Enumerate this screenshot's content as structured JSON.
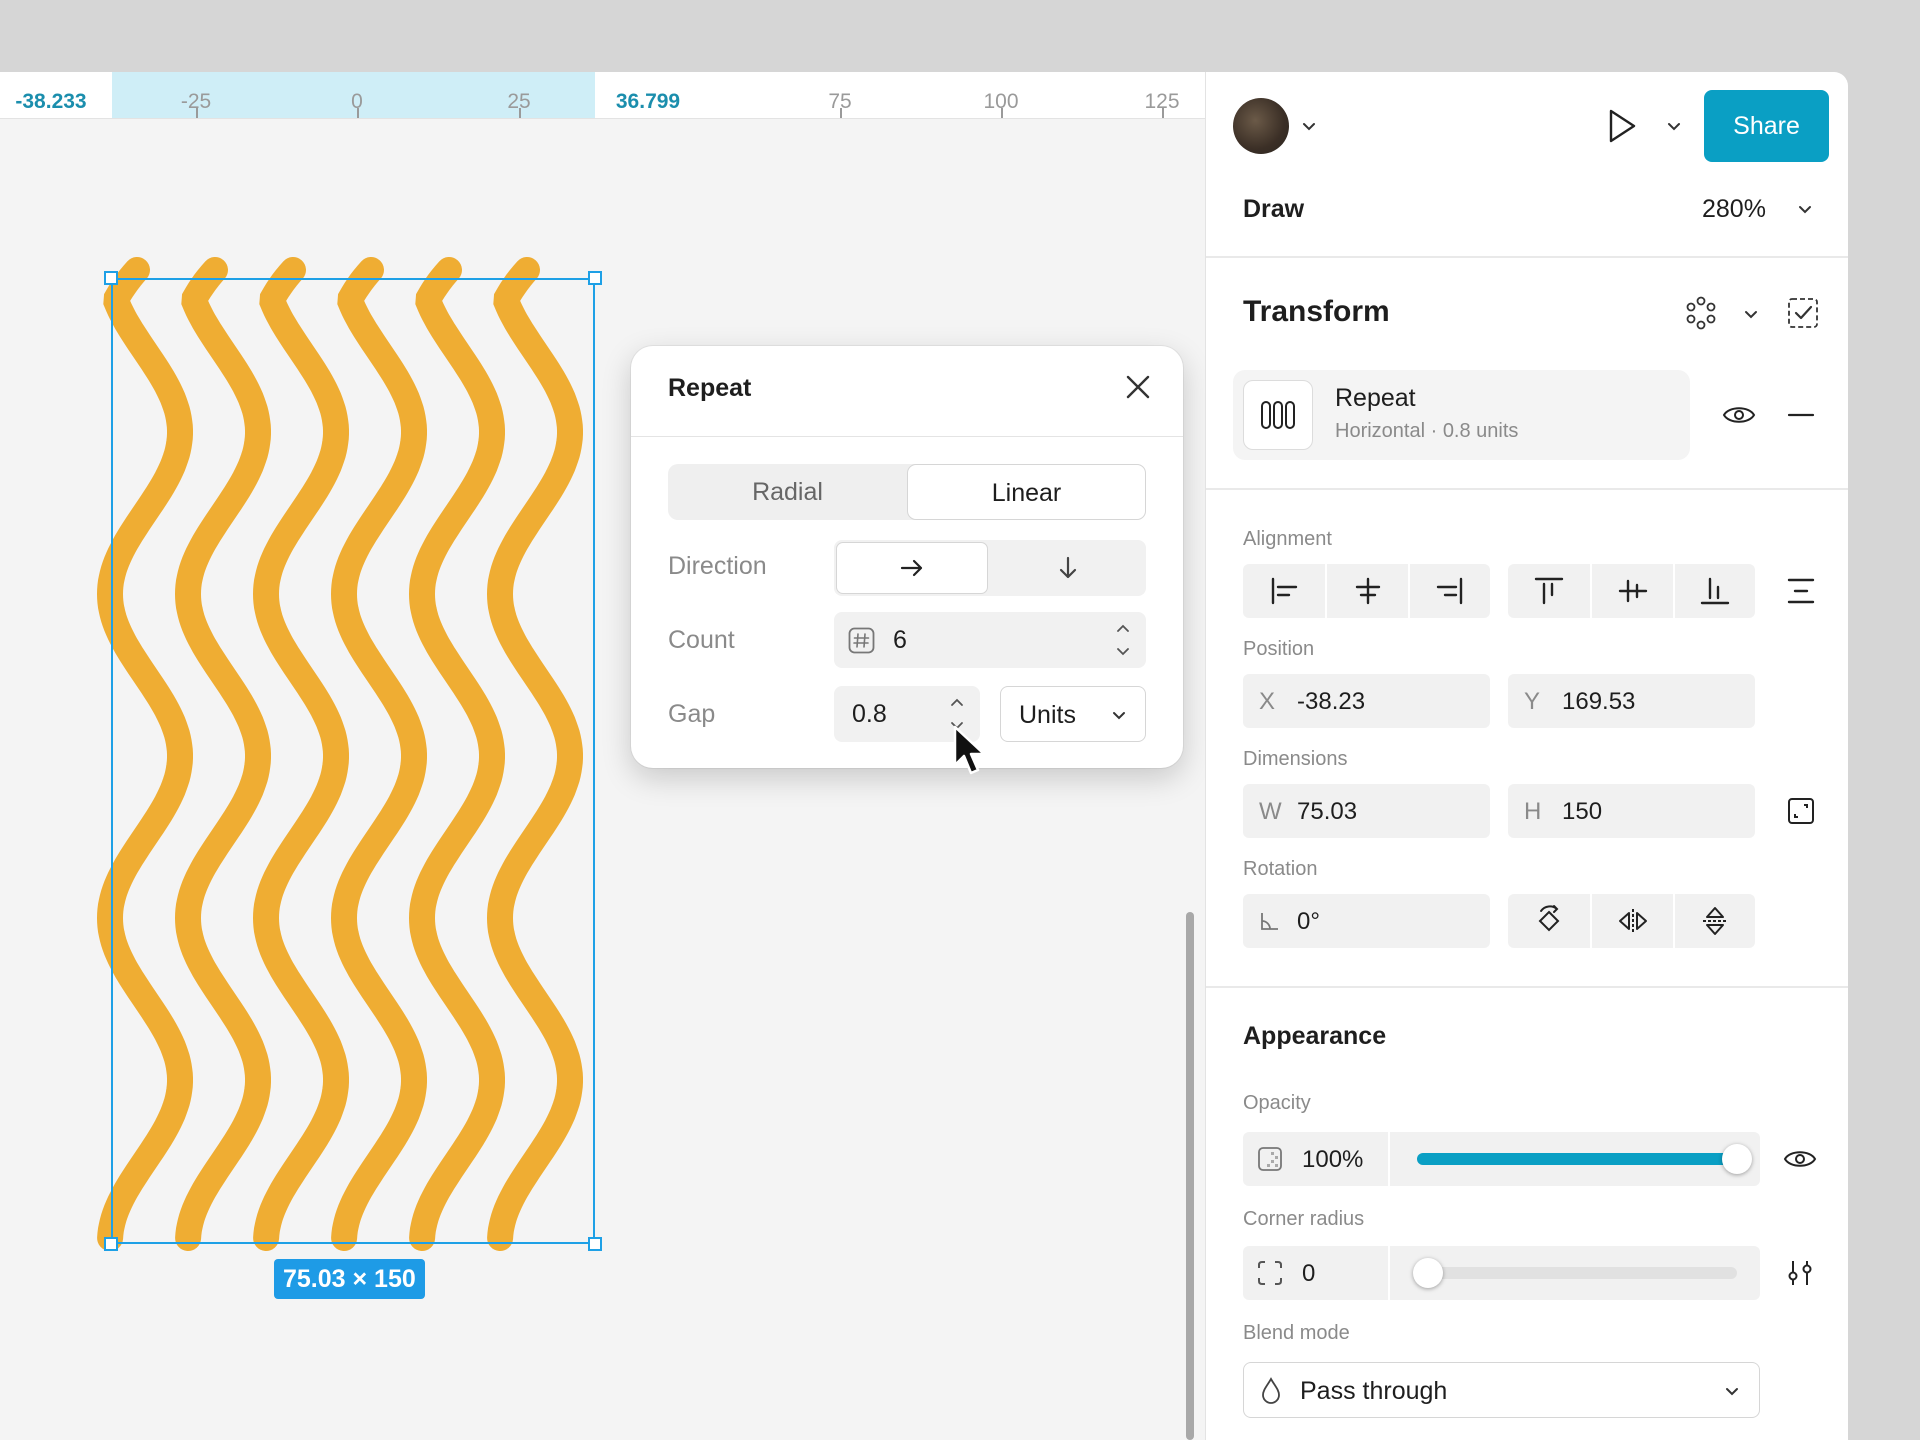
{
  "ruler": {
    "sel_start": "-38.233",
    "sel_end": "36.799",
    "ticks": [
      "-25",
      "0",
      "25",
      "75",
      "100",
      "125"
    ]
  },
  "canvas": {
    "dimension_badge": "75.03 × 150",
    "shape_color": "#efad33"
  },
  "repeat_popup": {
    "title": "Repeat",
    "tabs": [
      "Radial",
      "Linear"
    ],
    "active_tab": "Linear",
    "direction_label": "Direction",
    "count_label": "Count",
    "count_value": "6",
    "gap_label": "Gap",
    "gap_value": "0.8",
    "gap_unit": "Units"
  },
  "header": {
    "share_label": "Share",
    "mode": "Draw",
    "zoom": "280%",
    "accent": "#0a9fc4"
  },
  "transform": {
    "title": "Transform",
    "effect_name": "Repeat",
    "effect_desc": "Horizontal · 0.8 units"
  },
  "alignment": {
    "label": "Alignment"
  },
  "position": {
    "label": "Position",
    "x_key": "X",
    "x": "-38.23",
    "y_key": "Y",
    "y": "169.53"
  },
  "dimensions": {
    "label": "Dimensions",
    "w_key": "W",
    "w": "75.03",
    "h_key": "H",
    "h": "150"
  },
  "rotation": {
    "label": "Rotation",
    "value": "0°"
  },
  "appearance": {
    "title": "Appearance",
    "opacity_label": "Opacity",
    "opacity": "100%",
    "opacity_fraction": 1.0,
    "corner_label": "Corner radius",
    "corner": "0",
    "corner_fraction": 0.0,
    "blend_label": "Blend mode",
    "blend": "Pass through"
  }
}
